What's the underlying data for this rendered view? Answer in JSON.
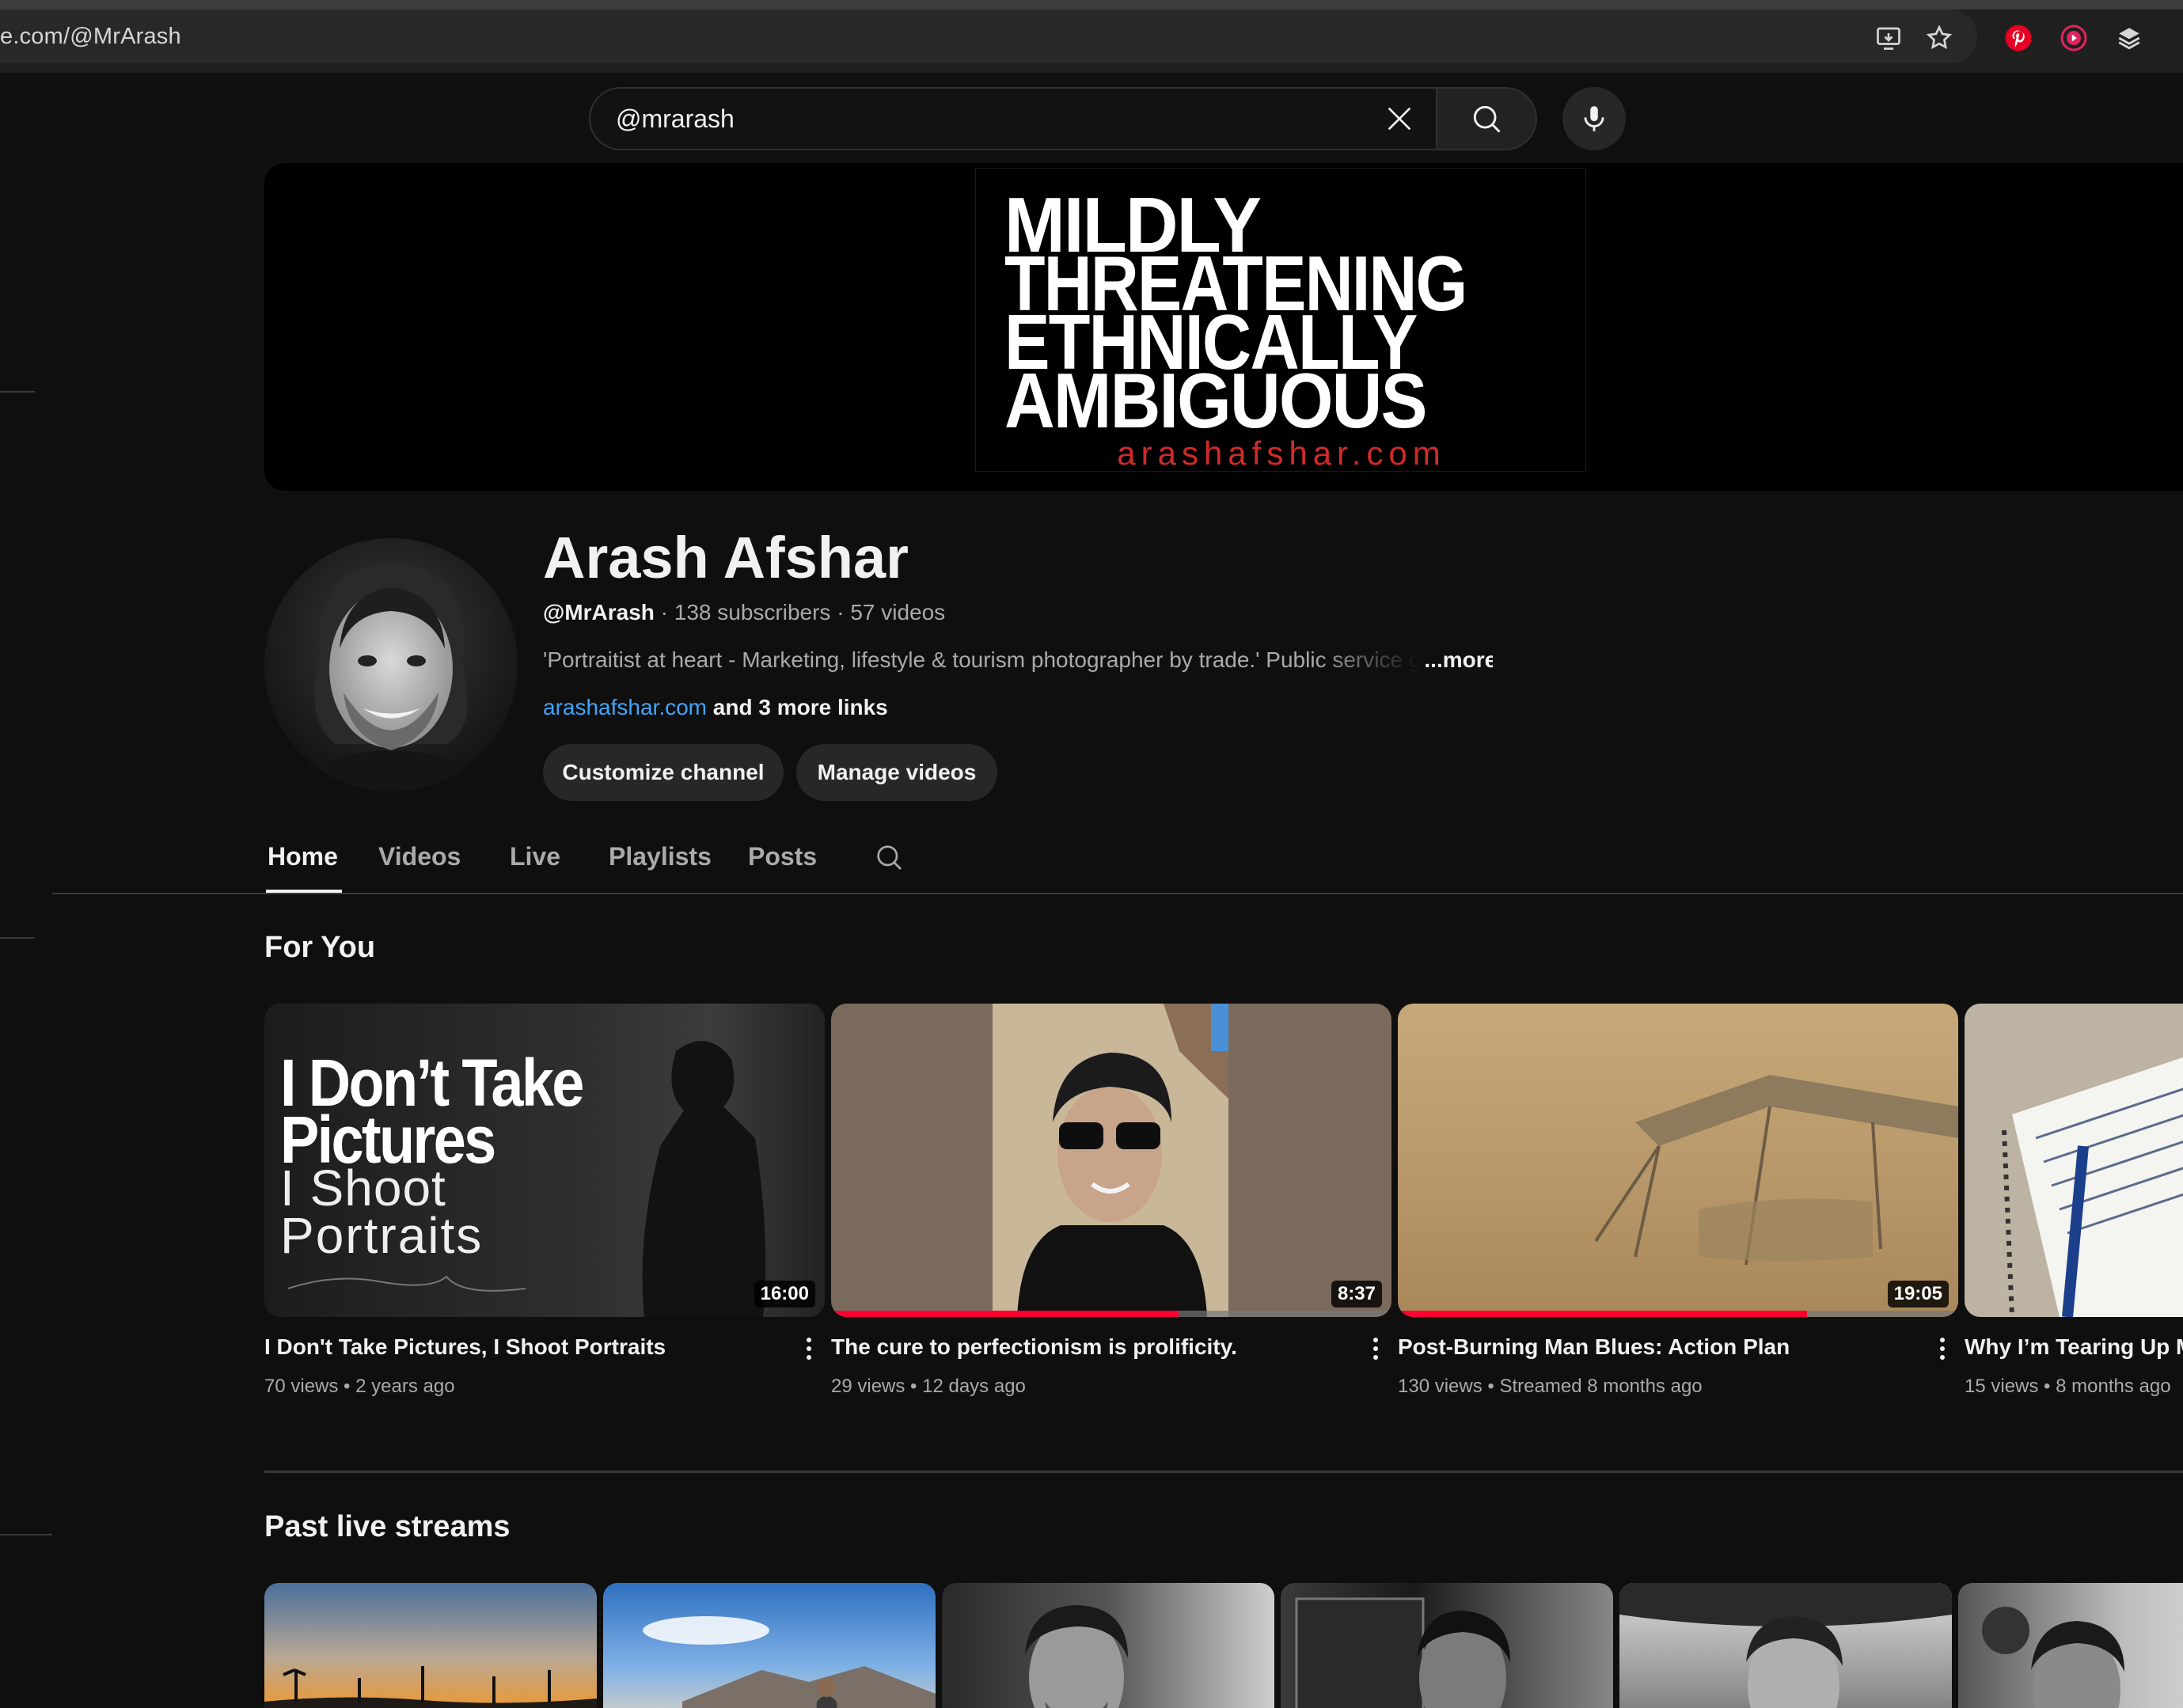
{
  "browser": {
    "url": "e.com/@MrArash"
  },
  "search": {
    "value": "@mrarash"
  },
  "banner": {
    "lines": [
      "MILDLY",
      "THREATENING",
      "ETHNICALLY",
      "AMBIGUOUS"
    ],
    "url": "arashafshar.com"
  },
  "channel": {
    "name": "Arash Afshar",
    "handle": "@MrArash",
    "subscribers": "· 138 subscribers",
    "videos": "· 57 videos",
    "description": "'Portraitist at heart - Marketing, lifestyle & tourism photographer by trade.' Public service g",
    "more": "...more",
    "link": "arashafshar.com",
    "more_links": "and 3 more links",
    "customize_label": "Customize channel",
    "manage_label": "Manage videos"
  },
  "tabs": [
    {
      "label": "Home",
      "active": true
    },
    {
      "label": "Videos"
    },
    {
      "label": "Live"
    },
    {
      "label": "Playlists"
    },
    {
      "label": "Posts"
    }
  ],
  "sections": {
    "for_you": "For You",
    "past_live": "Past live streams"
  },
  "for_you_videos": [
    {
      "title": "I Don't Take Pictures, I Shoot Portraits",
      "views": "70 views",
      "age": "2 years ago",
      "duration": "16:00",
      "thumb_lines": [
        "I Don’t Take",
        "Pictures",
        "I Shoot",
        "Portraits"
      ]
    },
    {
      "title": "The cure to perfectionism is prolificity.",
      "views": "29 views",
      "age": "12 days ago",
      "duration": "8:37",
      "progress": 0.62
    },
    {
      "title": "Post-Burning Man Blues: Action Plan",
      "views": "130 views",
      "age": "Streamed 8 months ago",
      "duration": "19:05",
      "progress": 0.73
    },
    {
      "title": "Why I’m Tearing Up My",
      "views": "15 views",
      "age": "8 months ago"
    }
  ],
  "colors": {
    "background": "#0f0f0f",
    "accent_red": "#ff0033",
    "link_blue": "#3ea6ff"
  }
}
